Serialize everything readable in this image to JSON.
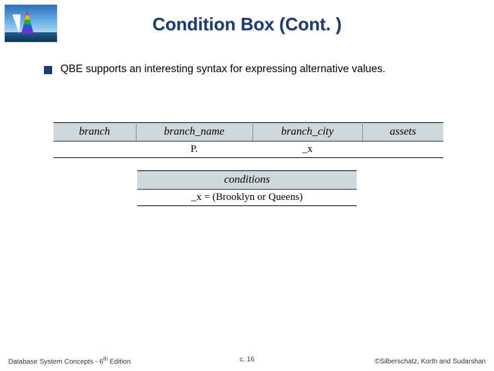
{
  "title": "Condition Box (Cont. )",
  "bullet": "QBE supports an interesting syntax for expressing alternative values.",
  "branch_table": {
    "headers": [
      "branch",
      "branch_name",
      "branch_city",
      "assets"
    ],
    "row": [
      "",
      "P.",
      "_x",
      ""
    ]
  },
  "cond_table": {
    "header": "conditions",
    "row": "_x = (Brooklyn or Queens)"
  },
  "footer": {
    "left_a": "Database System Concepts - 6",
    "left_sup": "th",
    "left_b": " Edition",
    "center": "c. 16",
    "right": "©Silberschatz, Korth and Sudarshan"
  }
}
